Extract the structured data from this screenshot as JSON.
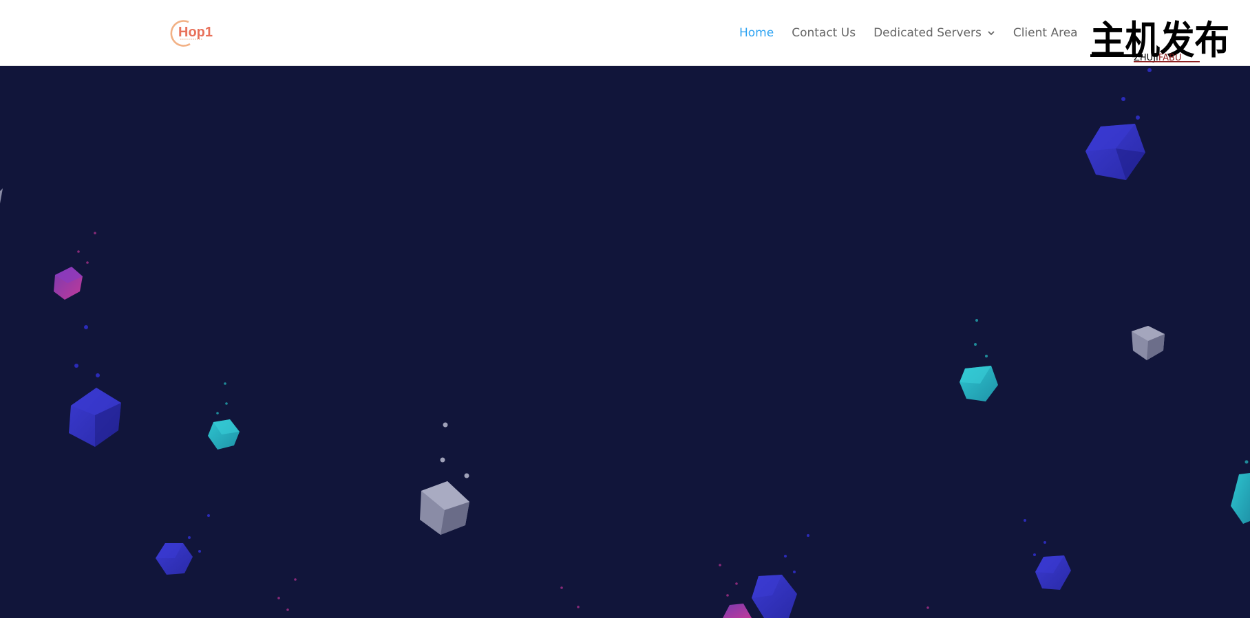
{
  "brand": {
    "logo_text": "Hop1"
  },
  "nav": {
    "items": [
      {
        "label": "Home",
        "active": true
      },
      {
        "label": "Contact Us",
        "active": false
      },
      {
        "label": "Dedicated Servers",
        "active": false,
        "has_dropdown": true
      },
      {
        "label": "Client Area",
        "active": false
      }
    ]
  },
  "watermark": {
    "chinese": "主机发布",
    "latin": "ZHUJIFABU"
  },
  "colors": {
    "header_bg": "#ffffff",
    "hero_bg": "#11153a",
    "nav_active": "#2ea3f2",
    "nav_text": "#666666",
    "logo_orange": "#f0a070",
    "logo_red": "#e0504a"
  },
  "icons": {
    "dropdown": "chevron-down-icon"
  }
}
